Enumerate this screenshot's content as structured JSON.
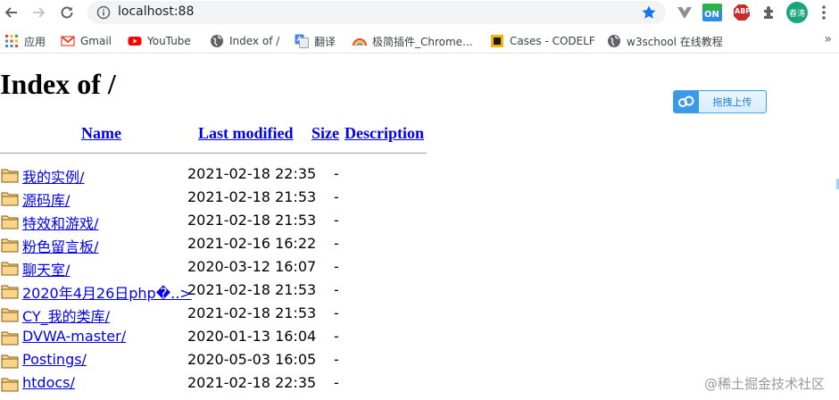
{
  "browser": {
    "url": "localhost:88",
    "bookmarks": [
      {
        "label": "应用",
        "icon": "apps-grid-icon"
      },
      {
        "label": "Gmail",
        "icon": "gmail-icon"
      },
      {
        "label": "YouTube",
        "icon": "youtube-icon"
      },
      {
        "label": "Index of /",
        "icon": "globe-icon"
      },
      {
        "label": "翻译",
        "icon": "translate-icon"
      },
      {
        "label": "极简插件_Chrome...",
        "icon": "rainbow-icon"
      },
      {
        "label": "Cases - CODELF",
        "icon": "codelf-icon"
      },
      {
        "label": "w3school 在线教程",
        "icon": "globe-icon"
      }
    ],
    "extensions": {
      "on_badge": "ON",
      "abp_badge": "ABP",
      "profile_label": "春涛"
    },
    "colors": {
      "star": "#1a73e8",
      "profile": "#1aa57a",
      "abp": "#c72c2c"
    }
  },
  "page": {
    "title": "Index of /",
    "upload_button": "拖拽上传",
    "columns": {
      "name": "Name",
      "last_modified": "Last modified",
      "size": "Size",
      "description": "Description"
    },
    "entries": [
      {
        "name": "我的实例/",
        "modified": "2021-02-18 22:35",
        "size": "-"
      },
      {
        "name": "源码库/",
        "modified": "2021-02-18 21:53",
        "size": "-"
      },
      {
        "name": "特效和游戏/",
        "modified": "2021-02-18 21:53",
        "size": "-"
      },
      {
        "name": "粉色留言板/",
        "modified": "2021-02-16 16:22",
        "size": "-"
      },
      {
        "name": "聊天室/",
        "modified": "2020-03-12 16:07",
        "size": "-"
      },
      {
        "name": "2020年4月26日php�..>",
        "modified": "2021-02-18 21:53",
        "size": "-"
      },
      {
        "name": "CY_我的类库/",
        "modified": "2021-02-18 21:53",
        "size": "-"
      },
      {
        "name": "DVWA-master/",
        "modified": "2020-01-13 16:04",
        "size": "-"
      },
      {
        "name": "Postings/",
        "modified": "2020-05-03 16:05",
        "size": "-"
      },
      {
        "name": "htdocs/",
        "modified": "2021-02-18 22:35",
        "size": "-"
      }
    ],
    "watermark": "@稀土掘金技术社区"
  }
}
